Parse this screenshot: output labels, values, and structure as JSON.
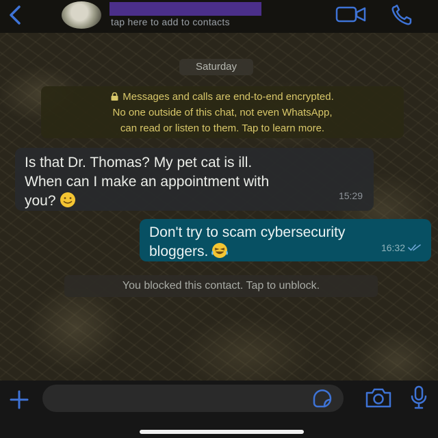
{
  "header": {
    "contact_hint": "tap here to add to contacts",
    "name_redacted_color": "#4b2f8a",
    "icons": [
      "back-icon",
      "video-call-icon",
      "phone-call-icon"
    ],
    "accent": "#3e73d6"
  },
  "chat": {
    "date_label": "Saturday",
    "encryption_notice": {
      "line1": "Messages and calls are end-to-end encrypted.",
      "line2": "No one outside of this chat, not even WhatsApp,",
      "line3": "can read or listen to them. Tap to learn more."
    },
    "messages": [
      {
        "direction": "incoming",
        "line1": "Is that Dr. Thomas? My pet cat is ill.",
        "line2": "When can I make an appointment with",
        "line3": "you?",
        "emoji": "slightly-smiling-face",
        "time": "15:29"
      },
      {
        "direction": "outgoing",
        "line1": "Don't try to scam cybersecurity",
        "line2": "bloggers.",
        "emoji": "laughing-face",
        "time": "16:32",
        "status": "read"
      }
    ],
    "blocked_notice": "You blocked this contact. Tap to unblock."
  },
  "composer": {
    "placeholder": "",
    "icons": [
      "plus-icon",
      "sticker-icon",
      "camera-icon",
      "microphone-icon"
    ]
  },
  "colors": {
    "incoming_bubble": "#282a2c",
    "outgoing_bubble": "#075063",
    "encryption_text": "#d9c86a"
  }
}
